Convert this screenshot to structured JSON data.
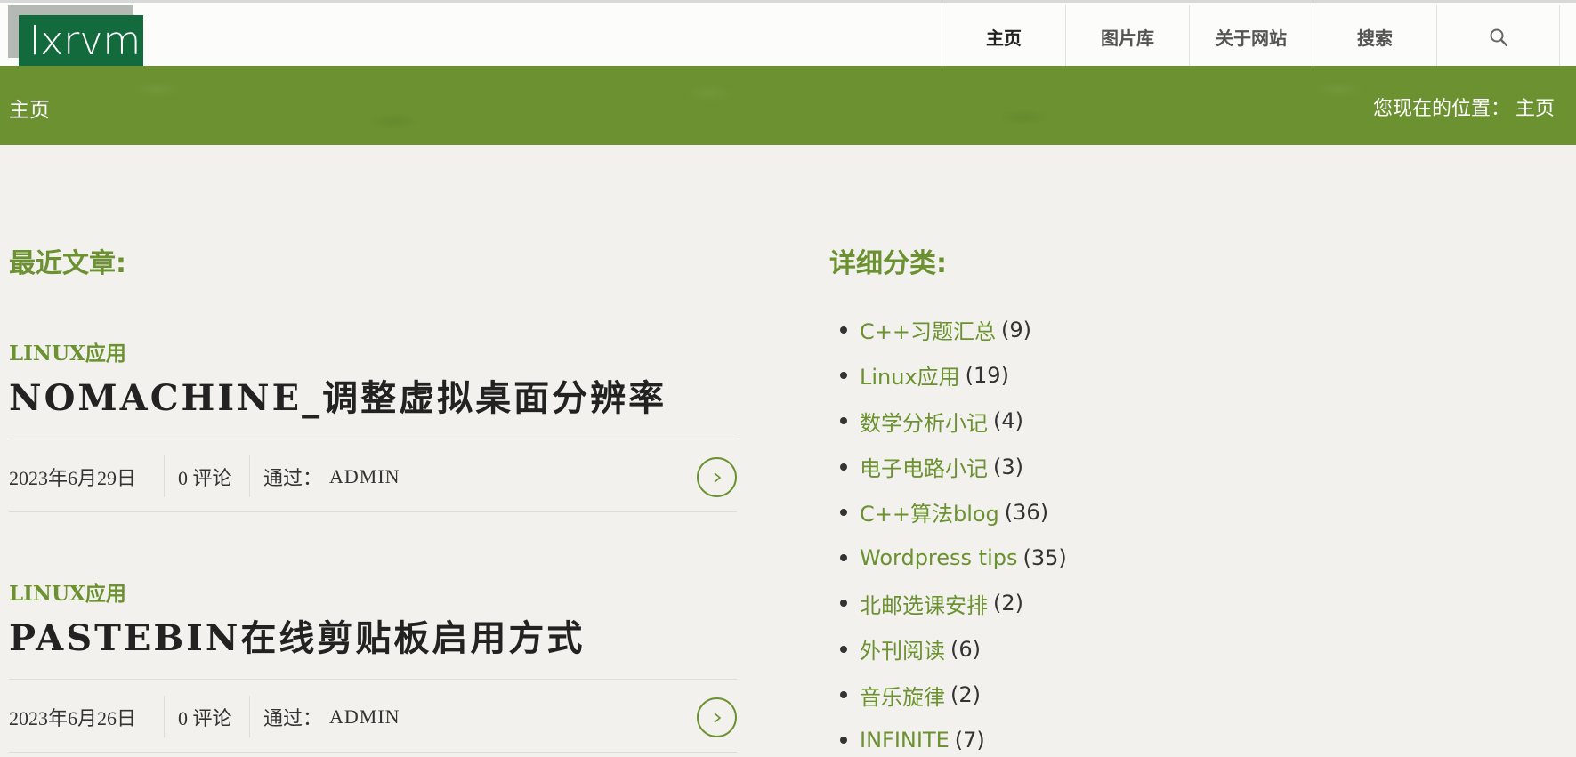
{
  "site": {
    "logo_text": "lxrvm"
  },
  "nav": {
    "items": [
      {
        "label": "主页"
      },
      {
        "label": "图片库"
      },
      {
        "label": "关于网站"
      },
      {
        "label": "搜索"
      }
    ],
    "search_icon": "search-icon"
  },
  "banner": {
    "title": "主页",
    "breadcrumb_prefix": "您现在的位置：",
    "breadcrumb_current": "主页"
  },
  "recent": {
    "heading": "最近文章:",
    "posts": [
      {
        "category": "LINUX应用",
        "title": "NOMACHINE_调整虚拟桌面分辨率",
        "date": "2023年6月29日",
        "comments": "0 评论",
        "by_label": "通过：",
        "author": "ADMIN"
      },
      {
        "category": "LINUX应用",
        "title": "PASTEBIN在线剪贴板启用方式",
        "date": "2023年6月26日",
        "comments": "0 评论",
        "by_label": "通过：",
        "author": "ADMIN"
      }
    ],
    "read_more_icon": "chevron-right-icon"
  },
  "categories": {
    "heading": "详细分类:",
    "items": [
      {
        "name": "C++习题汇总",
        "count": "(9)"
      },
      {
        "name": "Linux应用",
        "count": "(19)"
      },
      {
        "name": "数学分析小记",
        "count": "(4)"
      },
      {
        "name": "电子电路小记",
        "count": "(3)"
      },
      {
        "name": "C++算法blog",
        "count": "(36)"
      },
      {
        "name": "Wordpress tips",
        "count": "(35)"
      },
      {
        "name": "北邮选课安排",
        "count": "(2)"
      },
      {
        "name": "外刊阅读",
        "count": "(6)"
      },
      {
        "name": "音乐旋律",
        "count": "(2)"
      },
      {
        "name": "INFINITE",
        "count": "(7)"
      }
    ]
  },
  "colors": {
    "accent": "#6b9130",
    "logo_bg": "#136a3d",
    "page_bg": "#f2f1ed"
  }
}
